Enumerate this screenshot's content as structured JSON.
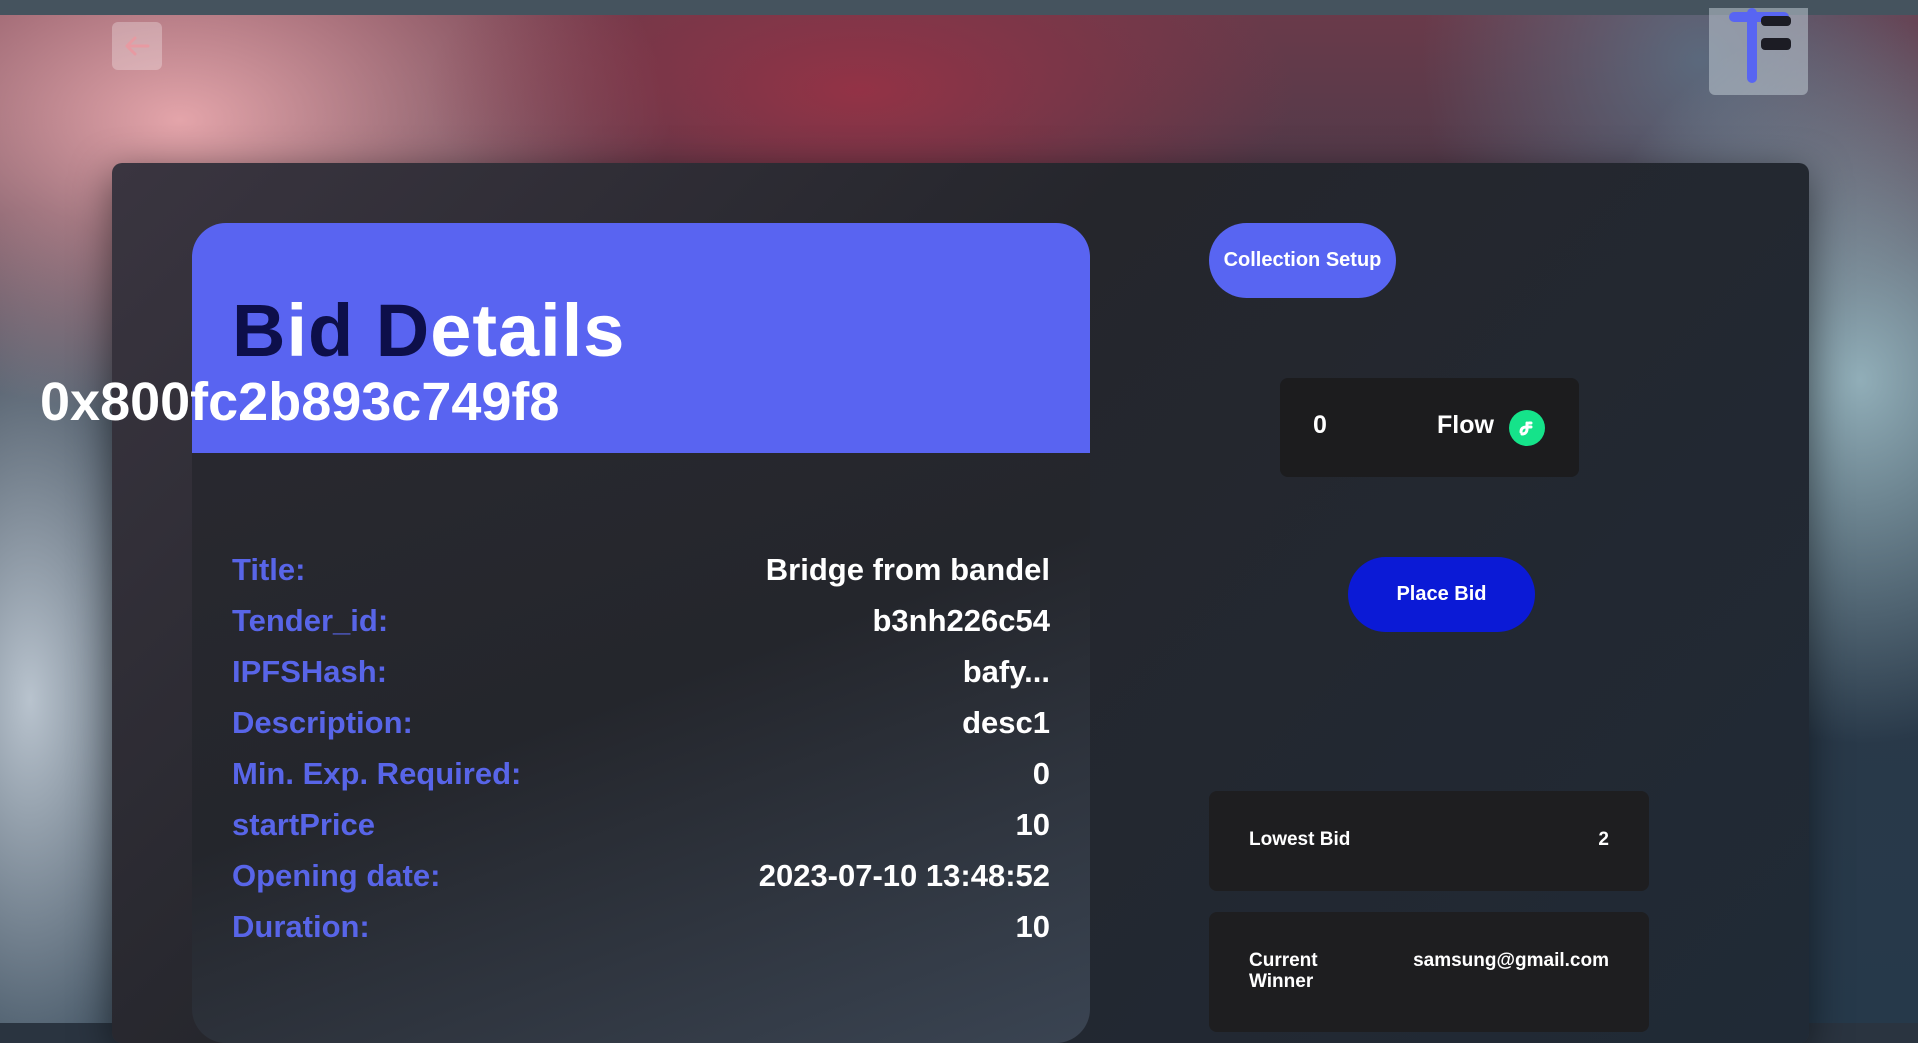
{
  "bid_details": {
    "title_part_dark_1": "B",
    "title_part_light_1": "i",
    "title_part_dark_2": "d D",
    "title_part_light_2": "etails",
    "address": "0x800fc2b893c749f8",
    "rows": [
      {
        "key": "Title:",
        "value": "Bridge from bandel"
      },
      {
        "key": "Tender_id:",
        "value": "b3nh226c54"
      },
      {
        "key": "IPFSHash:",
        "value": "bafy..."
      },
      {
        "key": "Description:",
        "value": "desc1"
      },
      {
        "key": "Min. Exp. Required:",
        "value": "0"
      },
      {
        "key": "startPrice",
        "value": "10"
      },
      {
        "key": "Opening date:",
        "value": "2023-07-10 13:48:52"
      },
      {
        "key": "Duration:",
        "value": "10"
      }
    ]
  },
  "actions": {
    "collection_setup": "Collection Setup",
    "place_bid": "Place Bid"
  },
  "balance": {
    "amount": "0",
    "currency": "Flow",
    "icon": "flow-token-icon"
  },
  "lowest_bid": {
    "label": "Lowest Bid",
    "value": "2"
  },
  "current_winner": {
    "label": "Current Winner",
    "value": "samsung@gmail.com"
  },
  "colors": {
    "accent": "#5964f1",
    "place_bid": "#0b1ad6",
    "flow_green": "#15e38a",
    "label_blue": "#5865e8"
  },
  "icons": {
    "back": "arrow-left-icon",
    "logo": "app-logo-icon"
  }
}
